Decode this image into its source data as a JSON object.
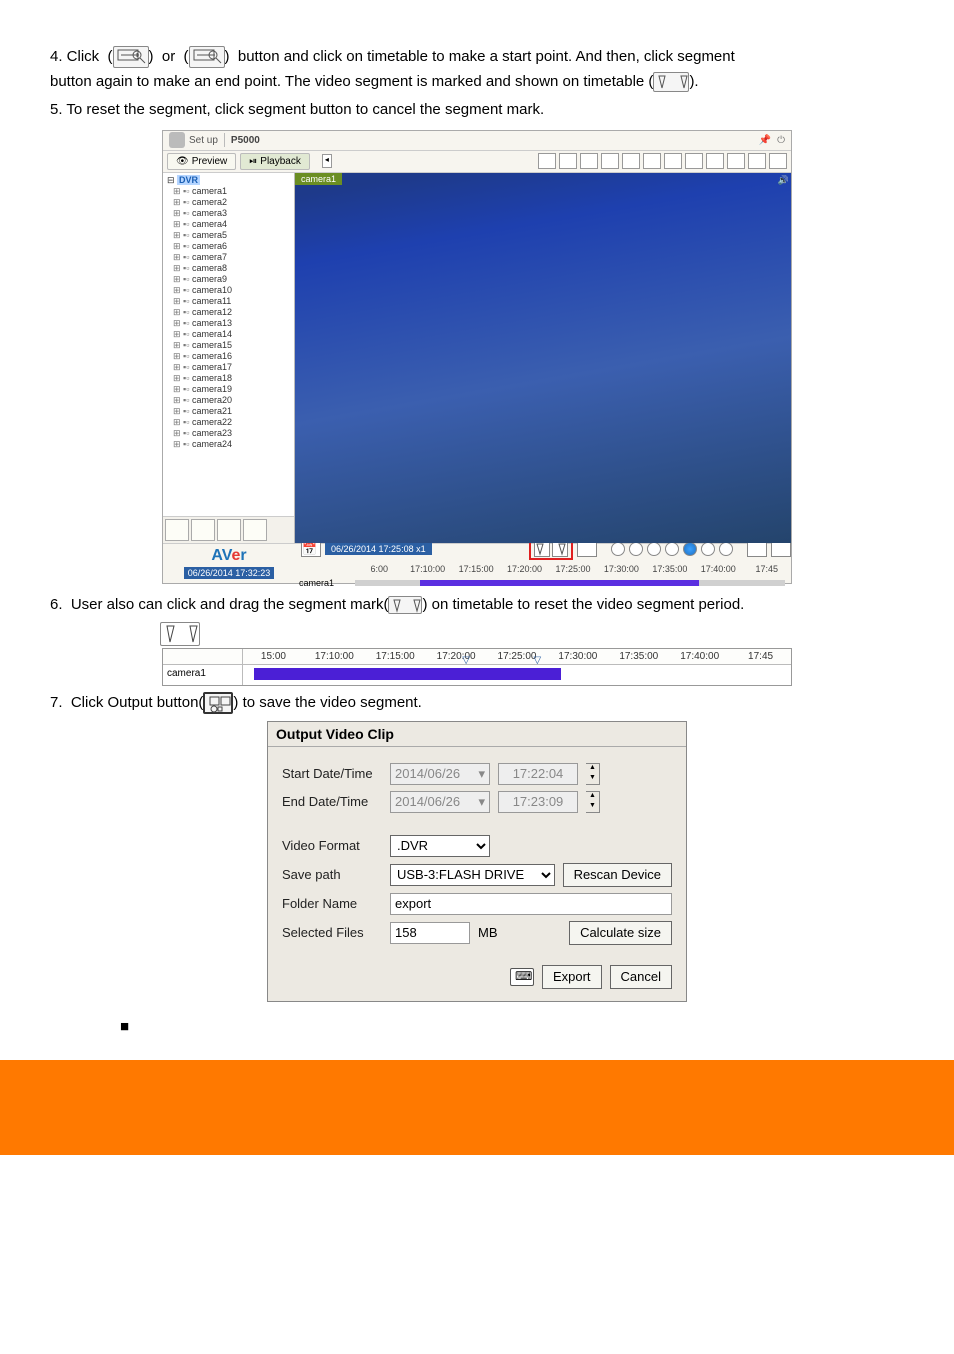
{
  "intro_text_1": "4. Click  (     )  or  (     )  button and click on timetable to make a start point. And then, click segment button again to make an end point. The video segment is marked and shown on timetable (     ).",
  "intro_text_2": "5. To reset the segment, click segment button to cancel the segment mark.",
  "segment_para": "6.  User also can click and drag the segment mark(       ) on timetable to reset the video segment period.",
  "export_para": "7.  Click Output button(     ) to save the video segment.",
  "dialog": {
    "title": "Output Video Clip",
    "start_label": "Start Date/Time",
    "start_date": "2014/06/26",
    "start_time": "17:22:04",
    "end_label": "End Date/Time",
    "end_date": "2014/06/26",
    "end_time": "17:23:09",
    "video_format_label": "Video Format",
    "video_format_value": ".DVR",
    "save_path_label": "Save path",
    "save_path_value": "USB-3:FLASH DRIVE",
    "rescan_btn": "Rescan Device",
    "folder_label": "Folder Name",
    "folder_value": "export",
    "selected_label": "Selected Files",
    "selected_value": "158",
    "selected_unit": "MB",
    "calc_btn": "Calculate size",
    "export_btn": "Export",
    "cancel_btn": "Cancel"
  },
  "app": {
    "title": "P5000",
    "setup_label": "Set up",
    "preview_tab": "Preview",
    "playback_tab": "Playback",
    "tree_root": "DVR",
    "cameras": [
      "camera1",
      "camera2",
      "camera3",
      "camera4",
      "camera5",
      "camera6",
      "camera7",
      "camera8",
      "camera9",
      "camera10",
      "camera11",
      "camera12",
      "camera13",
      "camera14",
      "camera15",
      "camera16",
      "camera17",
      "camera18",
      "camera19",
      "camera20",
      "camera21",
      "camera22",
      "camera23",
      "camera24"
    ],
    "brand": "AVer",
    "footer_timestamp": "06/26/2014 17:32:23",
    "playback_badge": "06/26/2014 17:25:08 x1",
    "active_cam": "camera1",
    "timeline_ticks": [
      "6:00",
      "17:10:00",
      "17:15:00",
      "17:20:00",
      "17:25:00",
      "17:30:00",
      "17:35:00",
      "17:40:00",
      "17:45"
    ]
  },
  "seg_timeline": {
    "ticks": [
      "15:00",
      "17:10:00",
      "17:15:00",
      "17:20:00",
      "17:25:00",
      "17:30:00",
      "17:35:00",
      "17:40:00",
      "17:45"
    ],
    "camera": "camera1"
  },
  "bullet1": "■"
}
